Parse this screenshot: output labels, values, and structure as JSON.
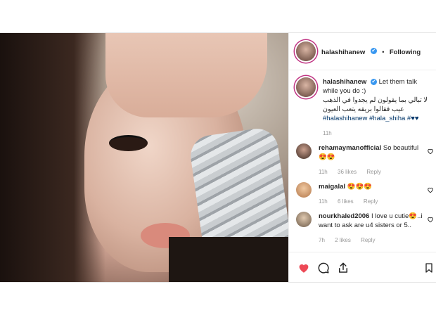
{
  "post": {
    "username": "halashihanew",
    "follow_label": "Following",
    "separator": "•",
    "verified_mark": "✔",
    "caption": {
      "lead": "Let them talk while you do :)",
      "arabic": "لا تبالي بما يقولون لم يجدوا في الذهب عيب فقالوا بريقه يتعب العيون",
      "hashtags": "#halashihanew #hala_shiha",
      "emoji": "#♥♥",
      "time": "11h"
    },
    "comments": [
      {
        "user": "rehamaymanofficial",
        "text": "So beautiful 😍😍",
        "time": "11h",
        "likes": "36 likes",
        "reply": "Reply"
      },
      {
        "user": "maigalal",
        "text": "😍😍😍",
        "time": "11h",
        "likes": "6 likes",
        "reply": "Reply"
      },
      {
        "user": "nourkhaled2006",
        "text": "I love u cutie😍..i want to ask are u4 sisters or 5..",
        "time": "7h",
        "likes": "2 likes",
        "reply": "Reply"
      }
    ],
    "icons": {
      "like": "heart-filled-icon",
      "comment": "comment-bubble-icon",
      "share": "share-icon",
      "save": "bookmark-icon",
      "comment_like": "heart-outline-icon"
    },
    "colors": {
      "like": "#ed4956",
      "verified": "#3897f0",
      "hashtag": "#003569"
    }
  }
}
